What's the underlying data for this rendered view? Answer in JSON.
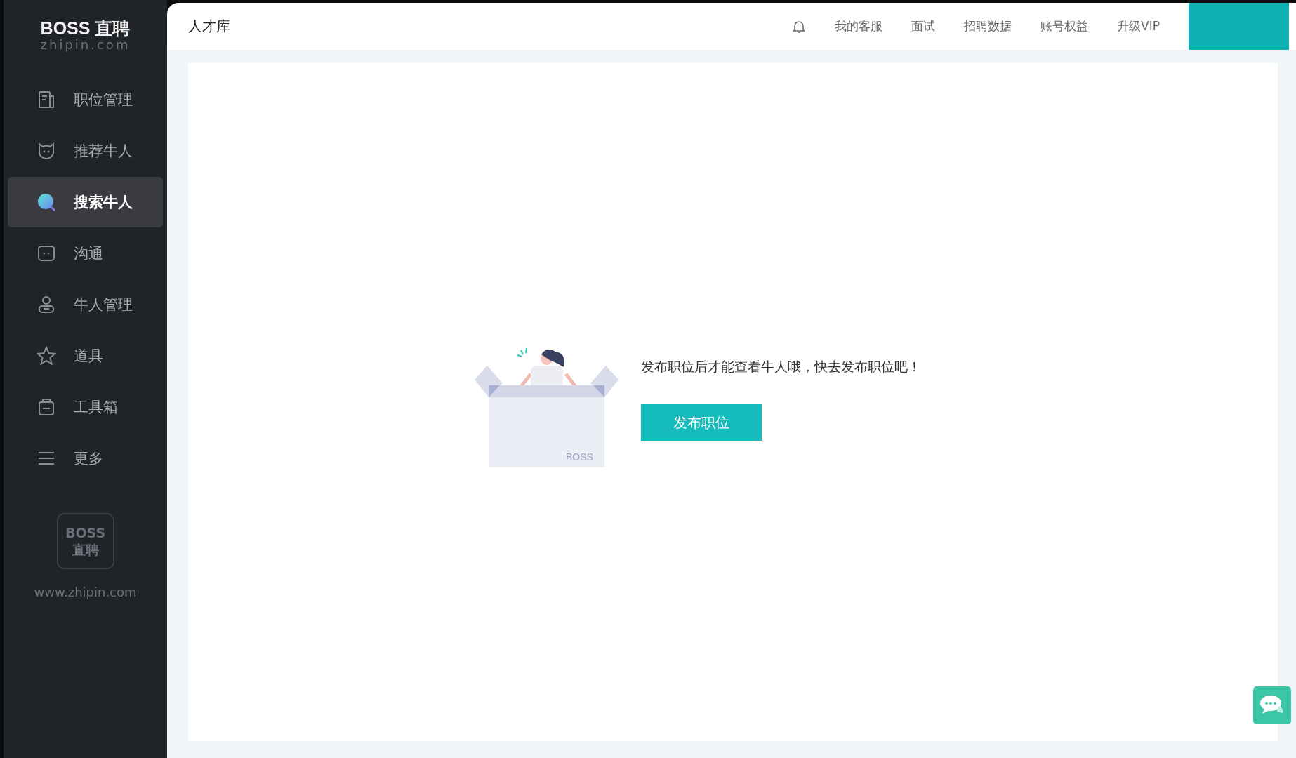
{
  "logo": {
    "brand": "BOSS 直聘",
    "domain": "zhipin.com"
  },
  "sidebar": {
    "items": [
      {
        "label": "职位管理",
        "selected": false
      },
      {
        "label": "推荐牛人",
        "selected": false
      },
      {
        "label": "搜索牛人",
        "selected": true
      },
      {
        "label": "沟通",
        "selected": false
      },
      {
        "label": "牛人管理",
        "selected": false
      },
      {
        "label": "道具",
        "selected": false
      },
      {
        "label": "工具箱",
        "selected": false
      },
      {
        "label": "更多",
        "selected": false
      }
    ],
    "footer_logo": {
      "line1": "BOSS",
      "line2": "直聘"
    },
    "footer_url": "www.zhipin.com"
  },
  "header": {
    "title": "人才库",
    "links": [
      "我的客服",
      "面试",
      "招聘数据",
      "账号权益",
      "升级VIP"
    ]
  },
  "empty_state": {
    "box_label": "BOSS",
    "message": "发布职位后才能查看牛人哦，快去发布职位吧！",
    "button": "发布职位"
  }
}
